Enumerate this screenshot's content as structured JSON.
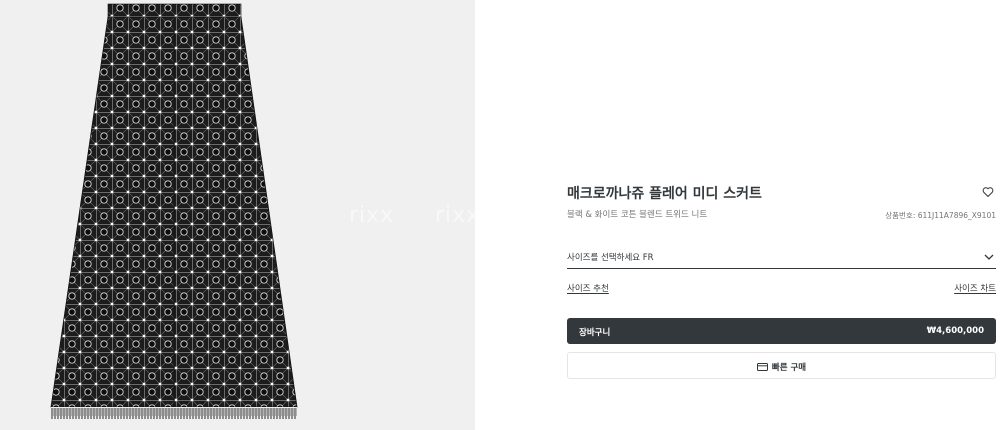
{
  "gallery": {
    "image_alt": "매크로까나쥬 플레어 미디 스커트 product image",
    "watermarks": [
      "rixx",
      "rixx",
      "rixx"
    ]
  },
  "product": {
    "title": "매크로까나쥬 플레어 미디 스커트",
    "subtitle": "블랙 & 화이트 코튼 블렌드 트위드 니트",
    "reference": "상품번호: 611J11A7896_X9101",
    "wishlist_icon": "heart-icon"
  },
  "size": {
    "select_label": "사이즈를 선택하세요 FR",
    "chevron_icon": "chevron-down-icon",
    "advisor_link": "사이즈 추천",
    "chart_link": "사이즈 차트"
  },
  "actions": {
    "cart_label": "장바구니",
    "price": "₩4,600,000",
    "quick_buy_label": "빠른 구매",
    "quick_buy_icon": "credit-card-icon"
  },
  "colors": {
    "primary": "#33383c",
    "gallery_bg": "#f0f0f0",
    "muted_text": "#757575"
  }
}
